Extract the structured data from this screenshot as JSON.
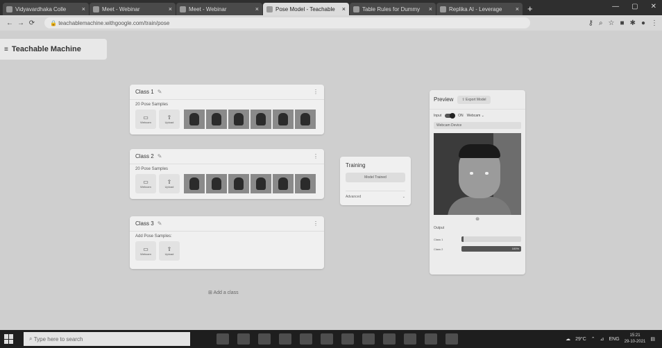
{
  "browser": {
    "tabs": [
      {
        "label": "Vidyavardhaka Colle",
        "active": false
      },
      {
        "label": "Meet - Webinar",
        "active": false
      },
      {
        "label": "Meet - Webinar",
        "active": false
      },
      {
        "label": "Pose Model - Teachable",
        "active": true
      },
      {
        "label": "Table Rules for Dummy",
        "active": false
      },
      {
        "label": "Replika AI - Leverage",
        "active": false
      }
    ],
    "url": "teachablemachine.withgoogle.com/train/pose"
  },
  "app": {
    "title": "Teachable Machine"
  },
  "classes": [
    {
      "name": "Class 1",
      "samples": "20 Pose Samples",
      "webcam": "Webcam",
      "upload": "Upload"
    },
    {
      "name": "Class 2",
      "samples": "20 Pose Samples",
      "webcam": "Webcam",
      "upload": "Upload"
    },
    {
      "name": "Class 3",
      "samples": "Add Pose Samples:",
      "webcam": "Webcam",
      "upload": "Upload"
    }
  ],
  "add_class": "Add a class",
  "training": {
    "title": "Training",
    "button": "Model Trained",
    "advanced": "Advanced"
  },
  "preview": {
    "title": "Preview",
    "export": "Export Model",
    "input_label": "Input",
    "input_state": "ON",
    "source": "Webcam",
    "camera_select": "Webcam Device",
    "output_label": "Output",
    "outputs": [
      {
        "label": "Class 1",
        "percent": 0
      },
      {
        "label": "Class 2",
        "percent": 100
      }
    ]
  },
  "taskbar": {
    "search": "Type here to search",
    "weather": "29°C",
    "lang": "ENG",
    "time": "15:21",
    "date": "29-10-2021"
  }
}
